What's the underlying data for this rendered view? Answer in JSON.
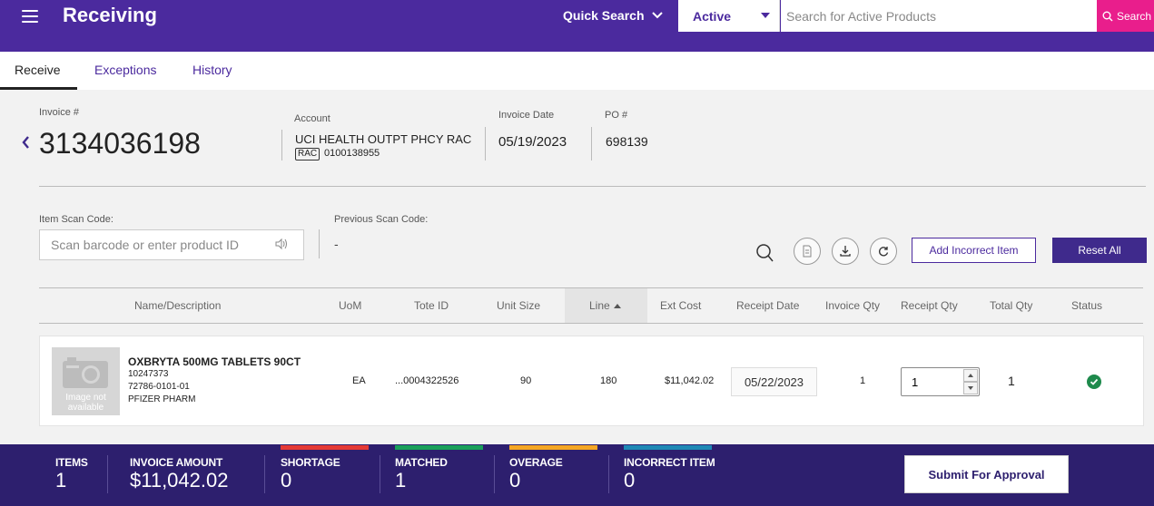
{
  "header": {
    "title": "Receiving",
    "quick_search_label": "Quick Search",
    "status_filter": "Active",
    "search_placeholder": "Search for Active Products",
    "search_button": "Search",
    "brand_color": "#4b2a9e",
    "search_button_color": "#e91e8c"
  },
  "tabs": [
    {
      "label": "Receive",
      "active": true
    },
    {
      "label": "Exceptions",
      "active": false
    },
    {
      "label": "History",
      "active": false
    }
  ],
  "invoice": {
    "number_label": "Invoice #",
    "number": "3134036198",
    "account_label": "Account",
    "account_name": "UCI HEALTH OUTPT PHCY RAC",
    "account_badge": "RAC",
    "account_number": "0100138955",
    "date_label": "Invoice Date",
    "date": "05/19/2023",
    "po_label": "PO #",
    "po": "698139"
  },
  "scan": {
    "item_label": "Item Scan Code:",
    "item_placeholder": "Scan barcode or enter product ID",
    "previous_label": "Previous Scan Code:",
    "previous_value": "-"
  },
  "actions": {
    "add_incorrect": "Add Incorrect Item",
    "reset_all": "Reset All"
  },
  "table": {
    "columns": [
      "Name/Description",
      "UoM",
      "Tote ID",
      "Unit Size",
      "Line",
      "Ext Cost",
      "Receipt Date",
      "Invoice Qty",
      "Receipt Qty",
      "Total Qty",
      "Status"
    ],
    "sorted_column": "Line",
    "rows": [
      {
        "image_text": "Image not available",
        "name": "OXBRYTA 500MG TABLETS 90CT",
        "item_number": "10247373",
        "ndc": "72786-0101-01",
        "manufacturer": "PFIZER PHARM",
        "uom": "EA",
        "tote_id": "...0004322526",
        "unit_size": "90",
        "line": "180",
        "ext_cost": "$11,042.02",
        "receipt_date": "05/22/2023",
        "invoice_qty": "1",
        "receipt_qty": "1",
        "total_qty": "1",
        "status": "check-circle-icon",
        "status_color": "#1e8a4c"
      }
    ]
  },
  "footer": {
    "items_label": "ITEMS",
    "items": "1",
    "amount_label": "INVOICE AMOUNT",
    "amount": "$11,042.02",
    "shortage_label": "SHORTAGE",
    "shortage": "0",
    "shortage_color": "#e53935",
    "matched_label": "MATCHED",
    "matched": "1",
    "matched_color": "#1aa05a",
    "overage_label": "OVERAGE",
    "overage": "0",
    "overage_color": "#f5a623",
    "incorrect_label": "INCORRECT ITEM",
    "incorrect": "0",
    "incorrect_color": "#1e88b5",
    "submit": "Submit For Approval"
  }
}
